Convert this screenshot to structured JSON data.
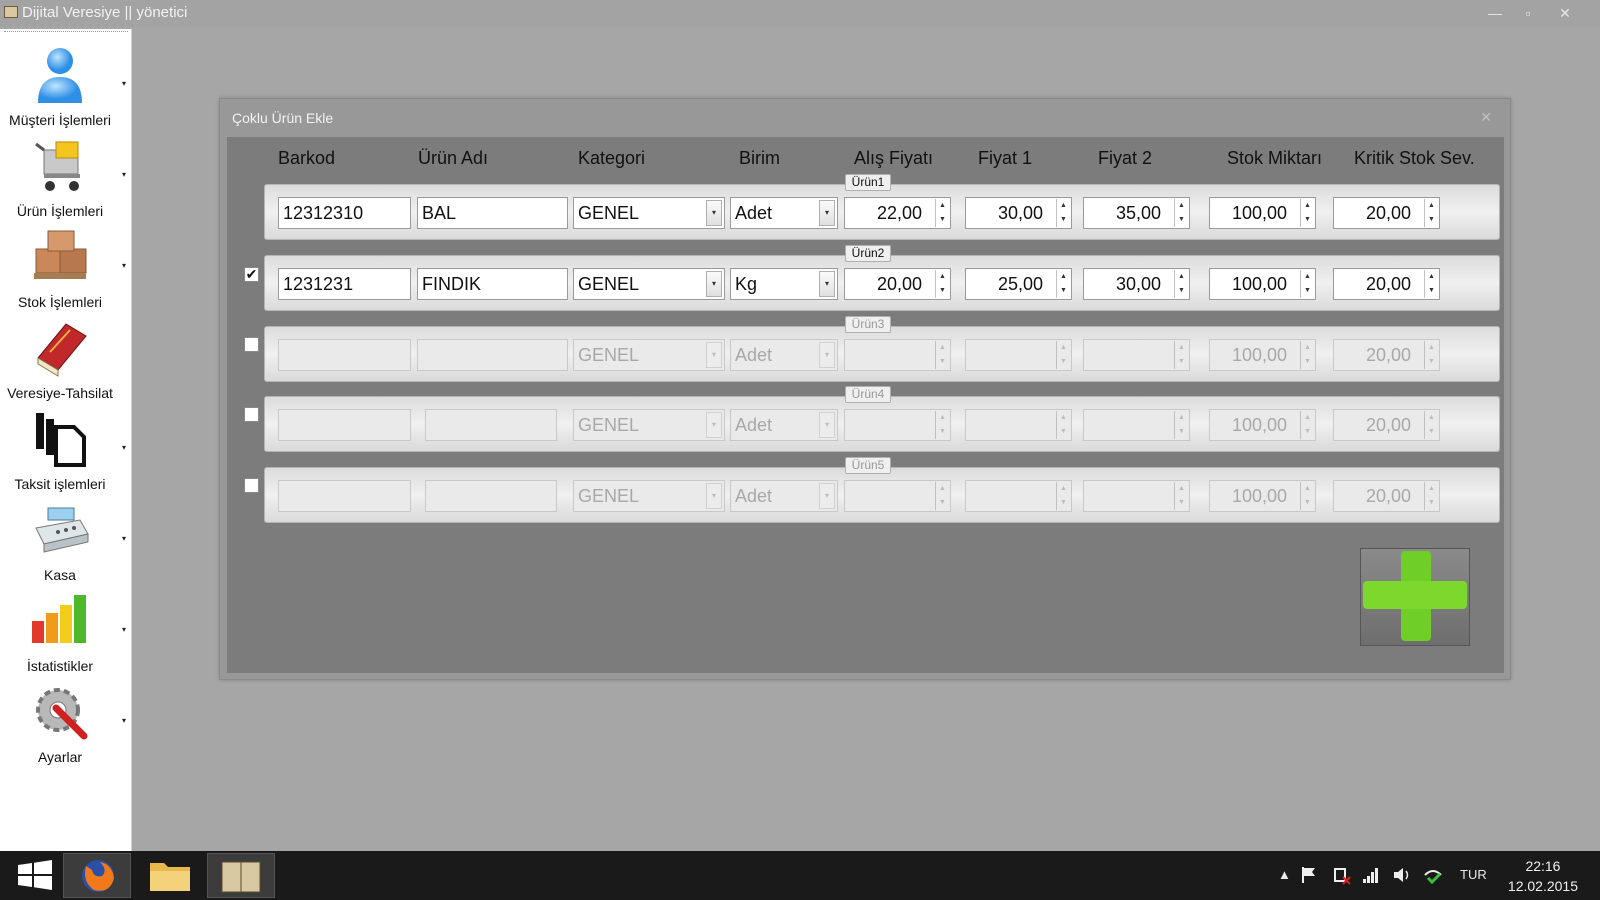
{
  "window": {
    "title": "Dijital Veresiye  ||  yönetici",
    "buttons": {
      "minimize": "—",
      "restore": "▫",
      "close": "✕"
    }
  },
  "sidebar": {
    "items": [
      {
        "label": "Müşteri İşlemleri",
        "icon": "user-icon"
      },
      {
        "label": "Ürün İşlemleri",
        "icon": "shopping-cart-icon"
      },
      {
        "label": "Stok İşlemleri",
        "icon": "boxes-icon"
      },
      {
        "label": "Veresiye-Tahsilat",
        "icon": "book-icon"
      },
      {
        "label": "Taksit işlemleri",
        "icon": "copy-pages-icon"
      },
      {
        "label": "Kasa",
        "icon": "cash-register-icon"
      },
      {
        "label": "İstatistikler",
        "icon": "bar-chart-icon"
      },
      {
        "label": "Ayarlar",
        "icon": "settings-wrench-icon"
      }
    ],
    "arrow": "▾"
  },
  "dialog": {
    "title": "Çoklu Ürün Ekle",
    "close": "✕",
    "columns": [
      "Barkod",
      "Ürün Adı",
      "Kategori",
      "Birim",
      "Alış Fiyatı",
      "Fiyat 1",
      "Fiyat 2",
      "Stok Miktarı",
      "Kritik Stok Sev."
    ],
    "rows": [
      {
        "tag": "Ürün1",
        "checkbox": null,
        "enabled": true,
        "barkod": "12312310",
        "urun_adi": "BAL",
        "kategori": "GENEL",
        "birim": "Adet",
        "alis": "22,00",
        "fiyat1": "30,00",
        "fiyat2": "35,00",
        "stok": "100,00",
        "kritik": "20,00"
      },
      {
        "tag": "Ürün2",
        "checkbox": "✔",
        "enabled": true,
        "barkod": "1231231",
        "urun_adi": "FINDIK",
        "kategori": "GENEL",
        "birim": "Kg",
        "alis": "20,00",
        "fiyat1": "25,00",
        "fiyat2": "30,00",
        "stok": "100,00",
        "kritik": "20,00"
      },
      {
        "tag": "Ürün3",
        "checkbox": "",
        "enabled": false,
        "barkod": "",
        "urun_adi": "",
        "kategori": "GENEL",
        "birim": "Adet",
        "alis": "",
        "fiyat1": "",
        "fiyat2": "",
        "stok": "100,00",
        "kritik": "20,00"
      },
      {
        "tag": "Ürün4",
        "checkbox": "",
        "enabled": false,
        "barkod": "",
        "urun_adi": "",
        "kategori": "GENEL",
        "birim": "Adet",
        "alis": "",
        "fiyat1": "",
        "fiyat2": "",
        "stok": "100,00",
        "kritik": "20,00"
      },
      {
        "tag": "Ürün5",
        "checkbox": "",
        "enabled": false,
        "barkod": "",
        "urun_adi": "",
        "kategori": "GENEL",
        "birim": "Adet",
        "alis": "",
        "fiyat1": "",
        "fiyat2": "",
        "stok": "100,00",
        "kritik": "20,00"
      }
    ],
    "spinner": {
      "up": "▲",
      "down": "▼"
    },
    "dropdown_arrow": "▾",
    "add_button_icon": "plus-icon"
  },
  "taskbar": {
    "tray_lang": "TUR",
    "time": "22:16",
    "date": "12.02.2015",
    "tray_arrow": "▲"
  },
  "colors": {
    "desktop": "#a6a6a6",
    "dialog_body": "#7c7c7c",
    "add_green": "#6fcf26",
    "taskbar": "#1a1a1a"
  }
}
